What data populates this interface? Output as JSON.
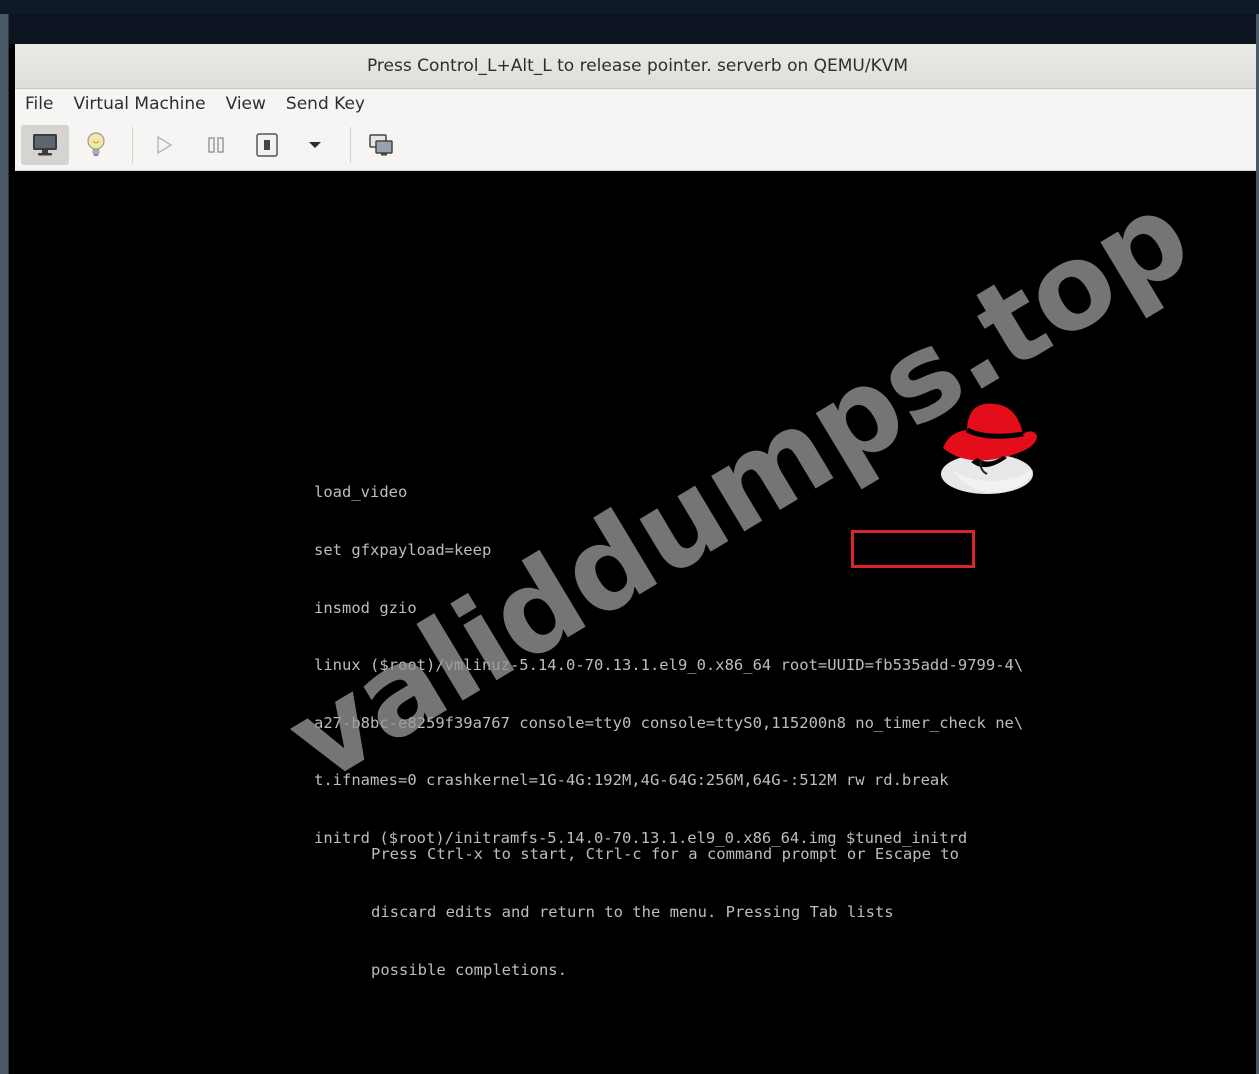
{
  "window": {
    "title": "Press Control_L+Alt_L to release pointer. serverb on QEMU/KVM"
  },
  "menu": {
    "items": [
      "File",
      "Virtual Machine",
      "View",
      "Send Key"
    ]
  },
  "toolbar": {
    "buttons": [
      {
        "icon": "monitor-icon",
        "state": "active"
      },
      {
        "icon": "lightbulb-icon"
      },
      {
        "icon": "play-icon"
      },
      {
        "icon": "pause-icon"
      },
      {
        "icon": "power-icon"
      },
      {
        "icon": "chevron-down-icon"
      },
      {
        "icon": "screens-icon"
      }
    ]
  },
  "grub": {
    "lines": [
      "load_video",
      "set gfxpayload=keep",
      "insmod gzio",
      "linux ($root)/vmlinuz-5.14.0-70.13.1.el9_0.x86_64 root=UUID=fb535add-9799-4\\",
      "a27-b8bc-e8259f39a767 console=tty0 console=ttyS0,115200n8 no_timer_check ne\\",
      "t.ifnames=0 crashkernel=1G-4G:192M,4G-64G:256M,64G-:512M rw rd.break",
      "initrd ($root)/initramfs-5.14.0-70.13.1.el9_0.x86_64.img $tuned_initrd"
    ],
    "help_lines": [
      "Press Ctrl-x to start, Ctrl-c for a command prompt or Escape to",
      "discard edits and return to the menu. Pressing Tab lists",
      "possible completions."
    ],
    "highlight_color": "#d9252a"
  },
  "watermark": {
    "text": "validdumps.top"
  },
  "colors": {
    "console_bg": "#000000",
    "console_text": "#bdbdbd",
    "logo_red": "#e30e1a"
  }
}
